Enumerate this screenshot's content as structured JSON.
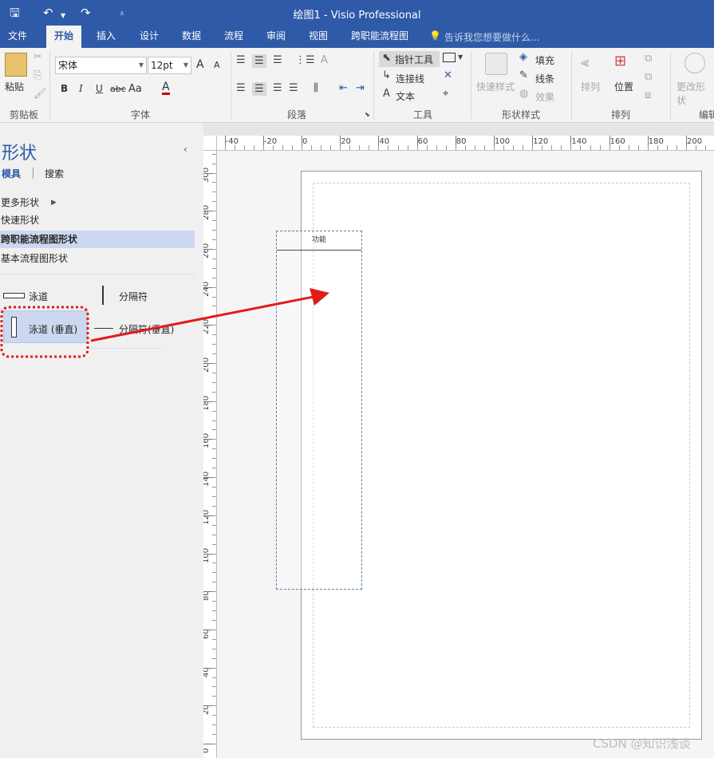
{
  "titlebar": {
    "title": "绘图1  -  Visio Professional"
  },
  "tabs": [
    "文件",
    "开始",
    "插入",
    "设计",
    "数据",
    "流程",
    "审阅",
    "视图",
    "跨职能流程图"
  ],
  "tell_me": "告诉我您想要做什么...",
  "ribbon": {
    "clipboard": {
      "paste": "粘贴",
      "label": "剪贴板"
    },
    "font": {
      "family": "宋体",
      "size": "12pt",
      "grow": "A",
      "shrink": "A",
      "bold": "B",
      "italic": "I",
      "underline": "U",
      "strike": "abc",
      "case": "Aa",
      "color": "A",
      "label": "字体"
    },
    "paragraph": {
      "label": "段落"
    },
    "tools": {
      "pointer": "指针工具",
      "connector": "连接线",
      "text": "文本",
      "label": "工具"
    },
    "shape_styles": {
      "quick": "快速样式",
      "fill": "填充",
      "line": "线条",
      "effect": "效果",
      "label": "形状样式"
    },
    "arrange": {
      "align": "排列",
      "position": "位置",
      "label": "排列"
    },
    "edit": {
      "change_shape": "更改形状",
      "label": "编辑"
    }
  },
  "shapes_pane": {
    "title": "形状",
    "tab_stencils": "模具",
    "tab_search": "搜索",
    "more_shapes": "更多形状",
    "quick_shapes": "快速形状",
    "cross_functional": "跨职能流程图形状",
    "basic_flowchart": "基本流程图形状",
    "stencil_items": {
      "swimlane": "泳道",
      "separator": "分隔符",
      "swimlane_vertical": "泳道 (垂直)",
      "separator_vertical": "分隔符(垂直)"
    }
  },
  "rulers": {
    "h_ticks": [
      "-40",
      "-20",
      "0",
      "20",
      "40",
      "60",
      "80",
      "100",
      "120",
      "140",
      "160",
      "180",
      "200"
    ],
    "v_ticks": [
      "300",
      "280",
      "260",
      "240",
      "220",
      "200",
      "180",
      "160",
      "140",
      "120",
      "100",
      "80",
      "60",
      "40",
      "20",
      "0"
    ]
  },
  "canvas": {
    "lane_header": "功能"
  },
  "watermark": "CSDN @知识浅谈",
  "colors": {
    "accent": "#2e5aa7",
    "arrow": "#e01b1b",
    "highlight": "#cbd8f0"
  }
}
